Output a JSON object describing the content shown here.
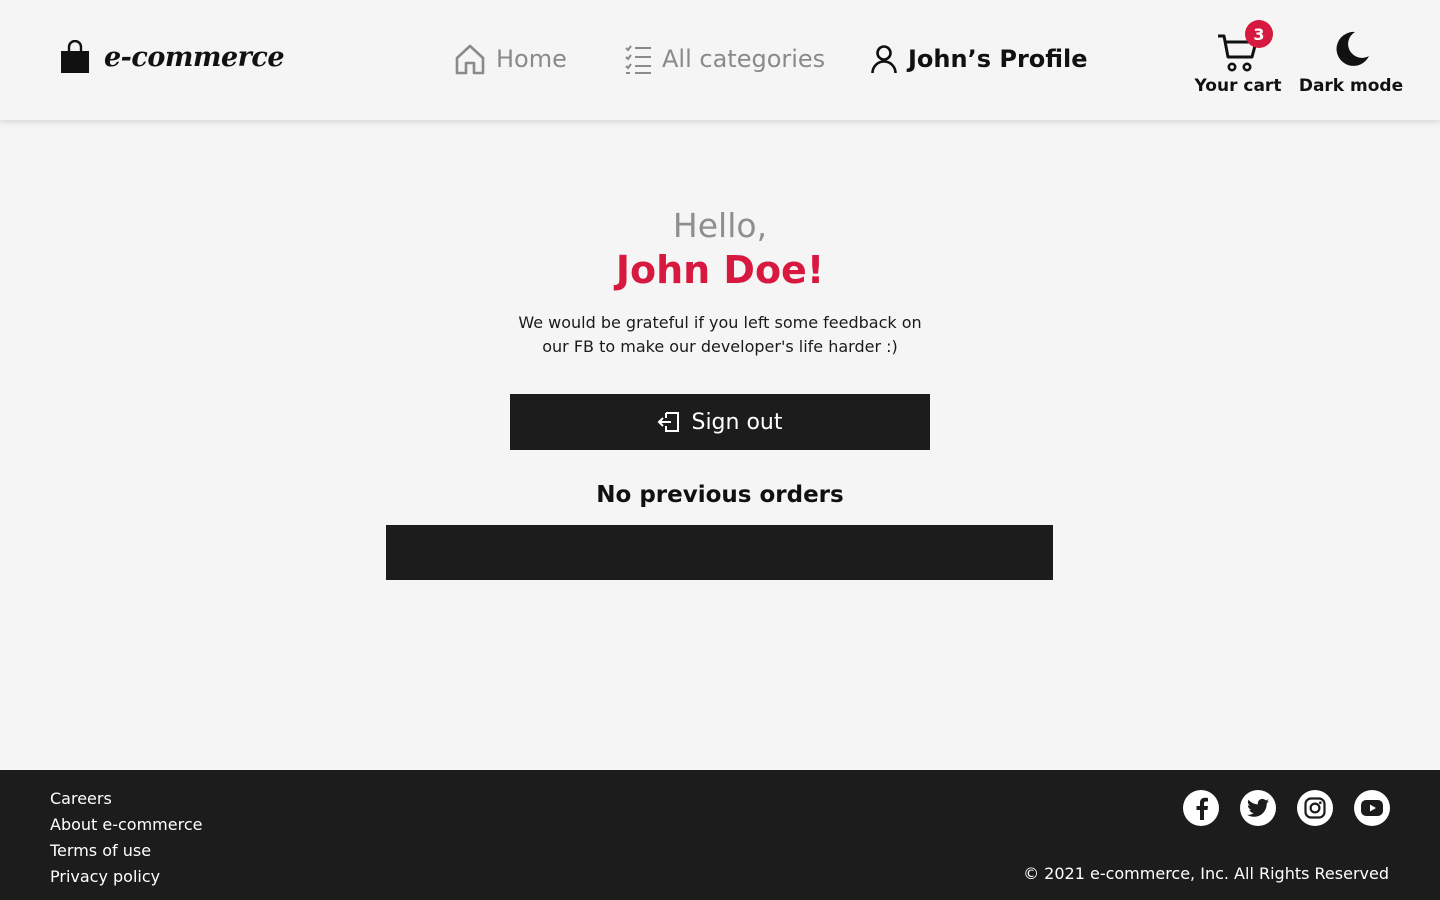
{
  "header": {
    "logo_text": "e-commerce",
    "nav": {
      "home": "Home",
      "categories": "All categories",
      "profile": "John’s Profile"
    },
    "cart": {
      "label": "Your cart",
      "count": "3"
    },
    "dark_mode": {
      "label": "Dark mode"
    }
  },
  "main": {
    "greeting": "Hello,",
    "user_name": "John Doe!",
    "feedback": "We would be grateful if you left some feedback on our FB to make our developer's life harder :)",
    "sign_out_label": "Sign out",
    "orders_title": "No previous orders"
  },
  "footer": {
    "links": [
      "Careers",
      "About e-commerce",
      "Terms of use",
      "Privacy policy"
    ],
    "social_icons": [
      "facebook-icon",
      "twitter-icon",
      "instagram-icon",
      "youtube-icon"
    ],
    "copyright": "© 2021 e-commerce, Inc. All Rights Reserved"
  },
  "colors": {
    "accent": "#d7193f",
    "dark": "#1c1c1c",
    "background": "#f5f5f5",
    "muted_text": "#8a8a8a"
  }
}
